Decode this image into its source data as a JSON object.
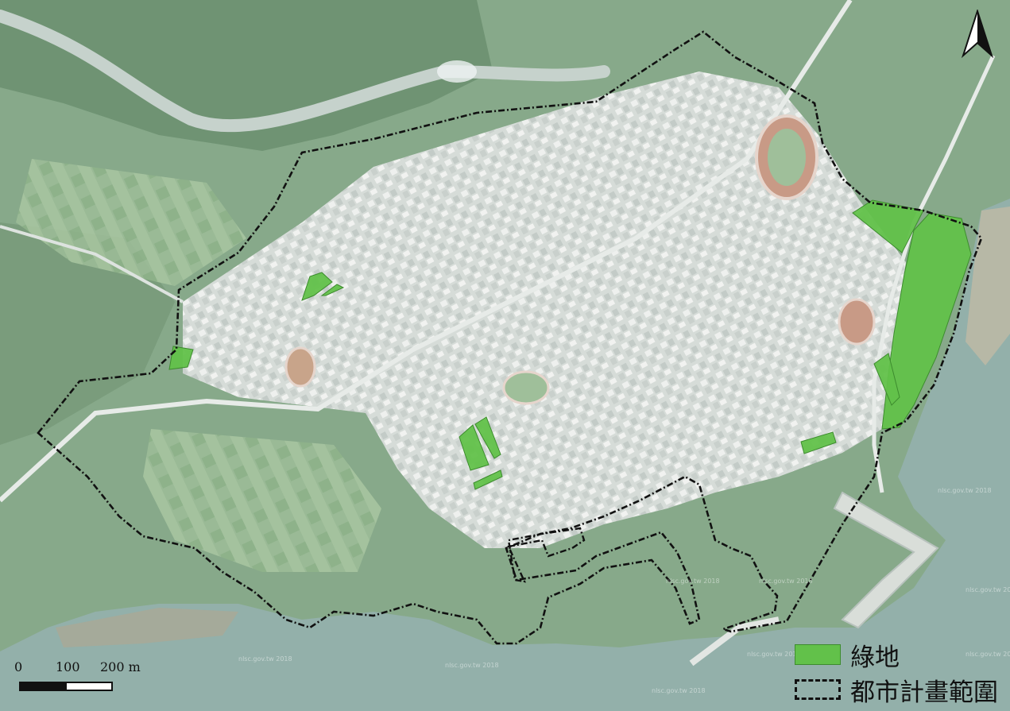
{
  "map": {
    "legend": {
      "green_space_label": "綠地",
      "plan_boundary_label": "都市計畫範圍",
      "green_color": "#62c14a",
      "boundary_color": "#111111"
    },
    "scale_bar": {
      "tick_0": "0",
      "tick_1": "100",
      "tick_2": "200 m"
    },
    "north_arrow": {
      "icon": "north-arrow-icon"
    }
  }
}
